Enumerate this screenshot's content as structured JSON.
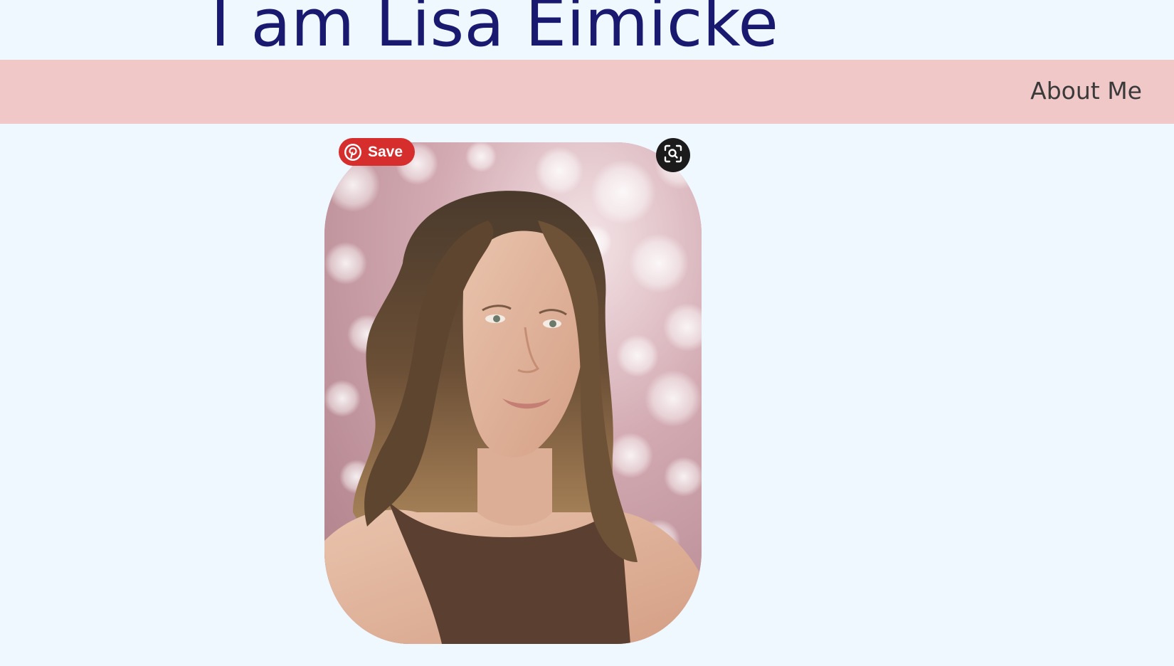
{
  "header": {
    "title": "I am Lisa Eimicke"
  },
  "nav": {
    "items": [
      {
        "label": "About Me"
      }
    ]
  },
  "portrait": {
    "alt": "Portrait photo"
  },
  "pinterest": {
    "save_label": "Save",
    "save_icon": "pinterest-logo-icon",
    "visual_search_icon": "visual-search-icon"
  },
  "colors": {
    "page_background": "#f0f8ff",
    "title": "#191970",
    "nav_background": "#f0c8c8",
    "nav_text": "#3a3a3a",
    "save_button": "#d62d2d",
    "visual_search_button": "#1b1b1b"
  }
}
